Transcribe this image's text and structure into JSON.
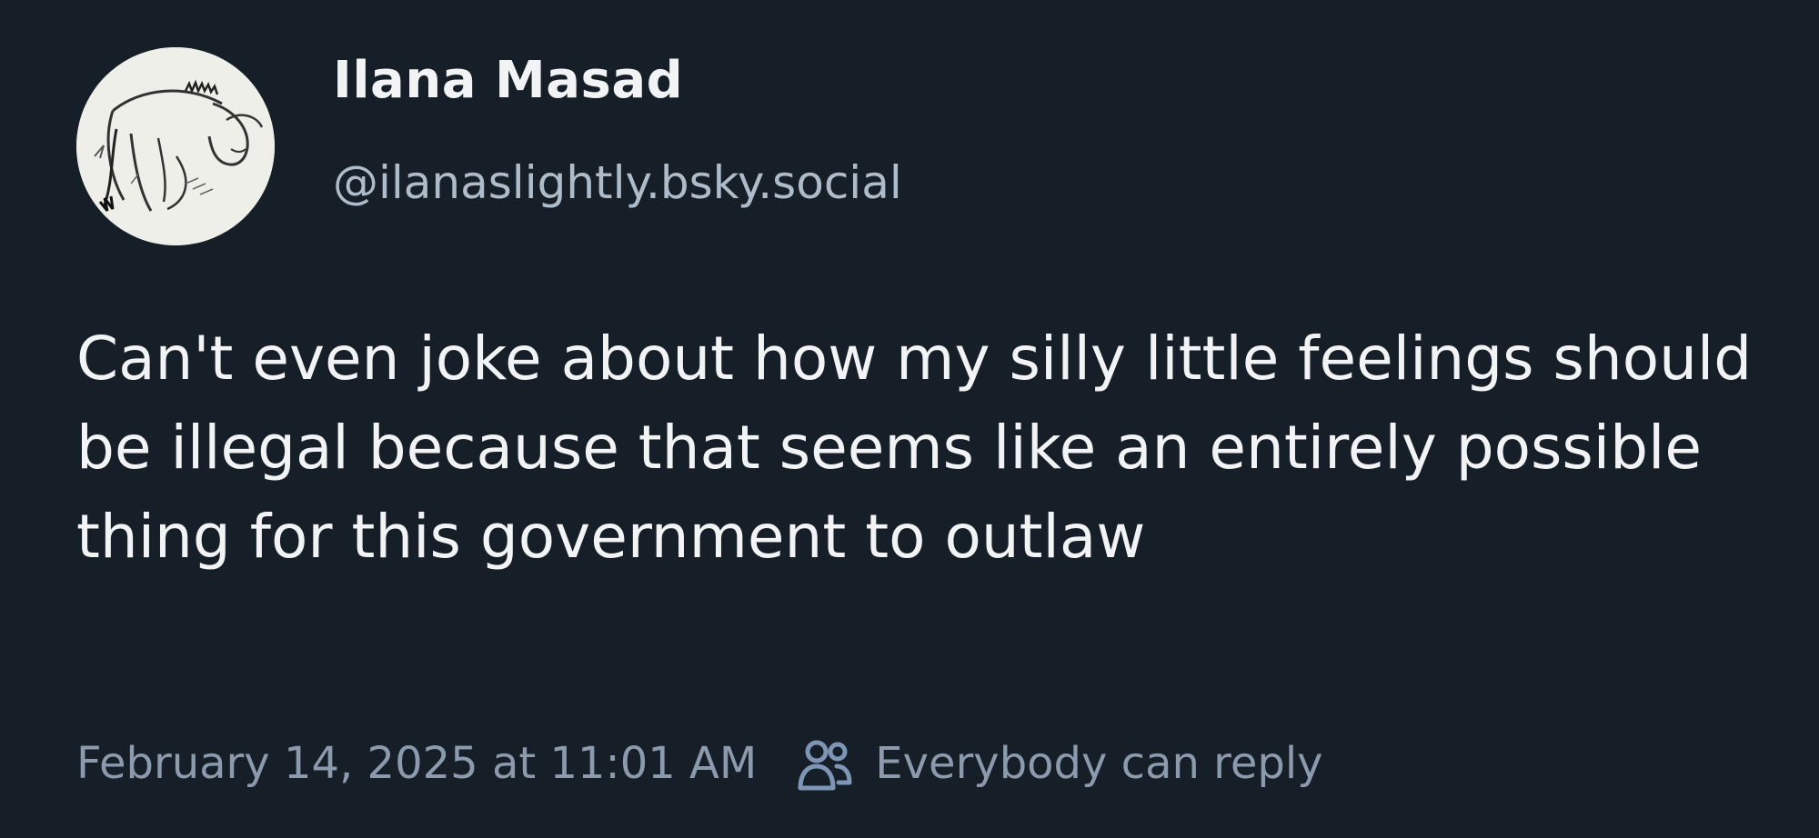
{
  "author": {
    "display_name": "Ilana Masad",
    "handle": "@ilanaslightly.bsky.social",
    "avatar_icon": "donkey-sketch-avatar"
  },
  "post": {
    "text": "Can't even joke about how my silly little feelings should be illegal because that seems like an entirely possible thing for this government to outlaw"
  },
  "meta": {
    "timestamp": "February 14, 2025 at 11:01 AM",
    "reply_setting_icon": "people-icon",
    "reply_setting": "Everybody can reply"
  },
  "colors": {
    "background": "#161e27",
    "primary_text": "#f1f3f5",
    "secondary_text": "#8b9aac",
    "icon_accent": "#7f95b5"
  }
}
